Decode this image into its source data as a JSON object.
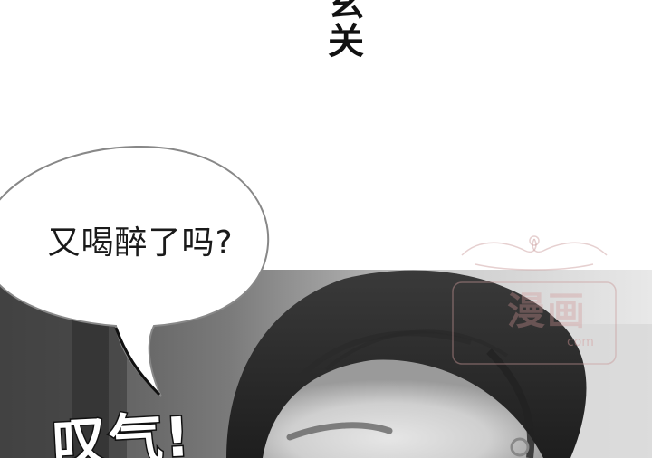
{
  "panel_top": {
    "sound_effect": "玄关"
  },
  "speech_bubble": {
    "text": "又喝醉了吗?"
  },
  "panel_bottom": {
    "sound_effect": "叹气!"
  },
  "watermark": {
    "text": "漫画",
    "url": "com"
  },
  "colors": {
    "background": "#ffffff",
    "ink": "#111111",
    "watermark": "#d29696"
  }
}
